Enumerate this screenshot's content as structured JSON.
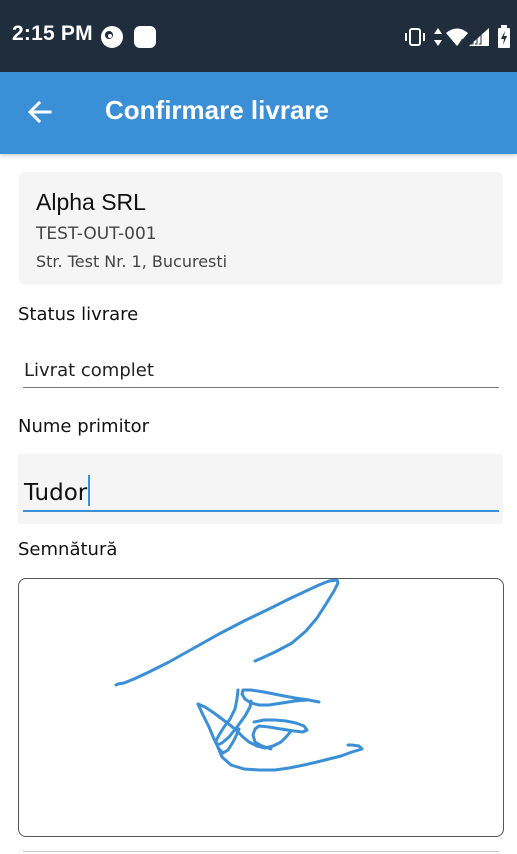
{
  "status_bar": {
    "time": "2:15 PM",
    "icons": [
      "notification-icon",
      "app-icon",
      "vibrate-icon",
      "data-arrows-icon",
      "wifi-icon",
      "signal-icon",
      "battery-icon"
    ]
  },
  "app_bar": {
    "title": "Confirmare livrare",
    "back_icon": "arrow-left-icon"
  },
  "customer_card": {
    "name": "Alpha SRL",
    "code": "TEST-OUT-001",
    "address": "Str. Test Nr. 1, Bucuresti"
  },
  "form": {
    "status_label": "Status livrare",
    "status_value": "Livrat complet",
    "recipient_label": "Nume primitor",
    "recipient_value": "Tudor",
    "signature_label": "Semnătură"
  },
  "colors": {
    "primary": "#3a8fd6",
    "status_bar": "#1f2d3d",
    "signature_stroke": "#3a8fd6"
  }
}
